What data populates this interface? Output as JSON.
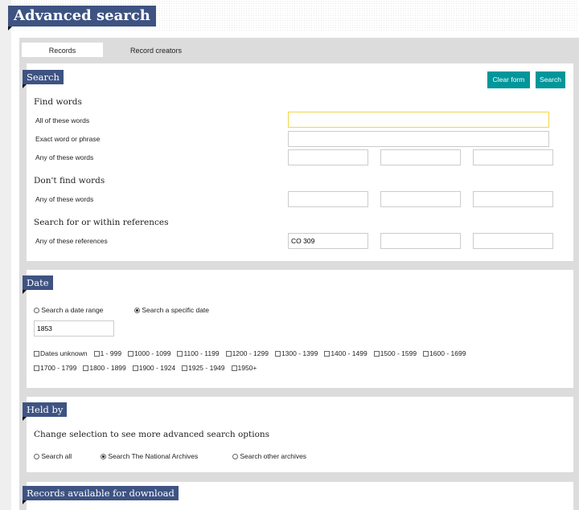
{
  "page": {
    "title": "Advanced search"
  },
  "tabs": [
    {
      "label": "Records",
      "active": true
    },
    {
      "label": "Record creators",
      "active": false
    }
  ],
  "search": {
    "heading": "Search",
    "clear_label": "Clear form",
    "search_label": "Search",
    "find_words": "Find words",
    "all_words": "All of these words",
    "exact_phrase": "Exact word or phrase",
    "any_words": "Any of these words",
    "dont_find": "Don't find words",
    "dont_any": "Any of these words",
    "refs_heading": "Search for or within references",
    "refs_any": "Any of these references",
    "ref_value": "CO 309"
  },
  "date": {
    "heading": "Date",
    "range_label": "Search a date range",
    "specific_label": "Search a specific date",
    "selected": "specific",
    "date_value": "1853",
    "ranges": [
      "Dates unknown",
      "1 - 999",
      "1000 - 1099",
      "1100 - 1199",
      "1200 - 1299",
      "1300 - 1399",
      "1400 - 1499",
      "1500 - 1599",
      "1600 - 1699",
      "1700 - 1799",
      "1800 - 1899",
      "1900 - 1924",
      "1925 - 1949",
      "1950+"
    ]
  },
  "held_by": {
    "heading": "Held by",
    "instruction": "Change selection to see more advanced search options",
    "options": [
      {
        "label": "Search all",
        "selected": false
      },
      {
        "label": "Search The National Archives",
        "selected": true
      },
      {
        "label": "Search other archives",
        "selected": false
      }
    ]
  },
  "download": {
    "heading": "Records available for download"
  },
  "colors": {
    "heading_bg": "#3e5382",
    "button_bg": "#00969a",
    "focus_border": "#f0d64a"
  }
}
